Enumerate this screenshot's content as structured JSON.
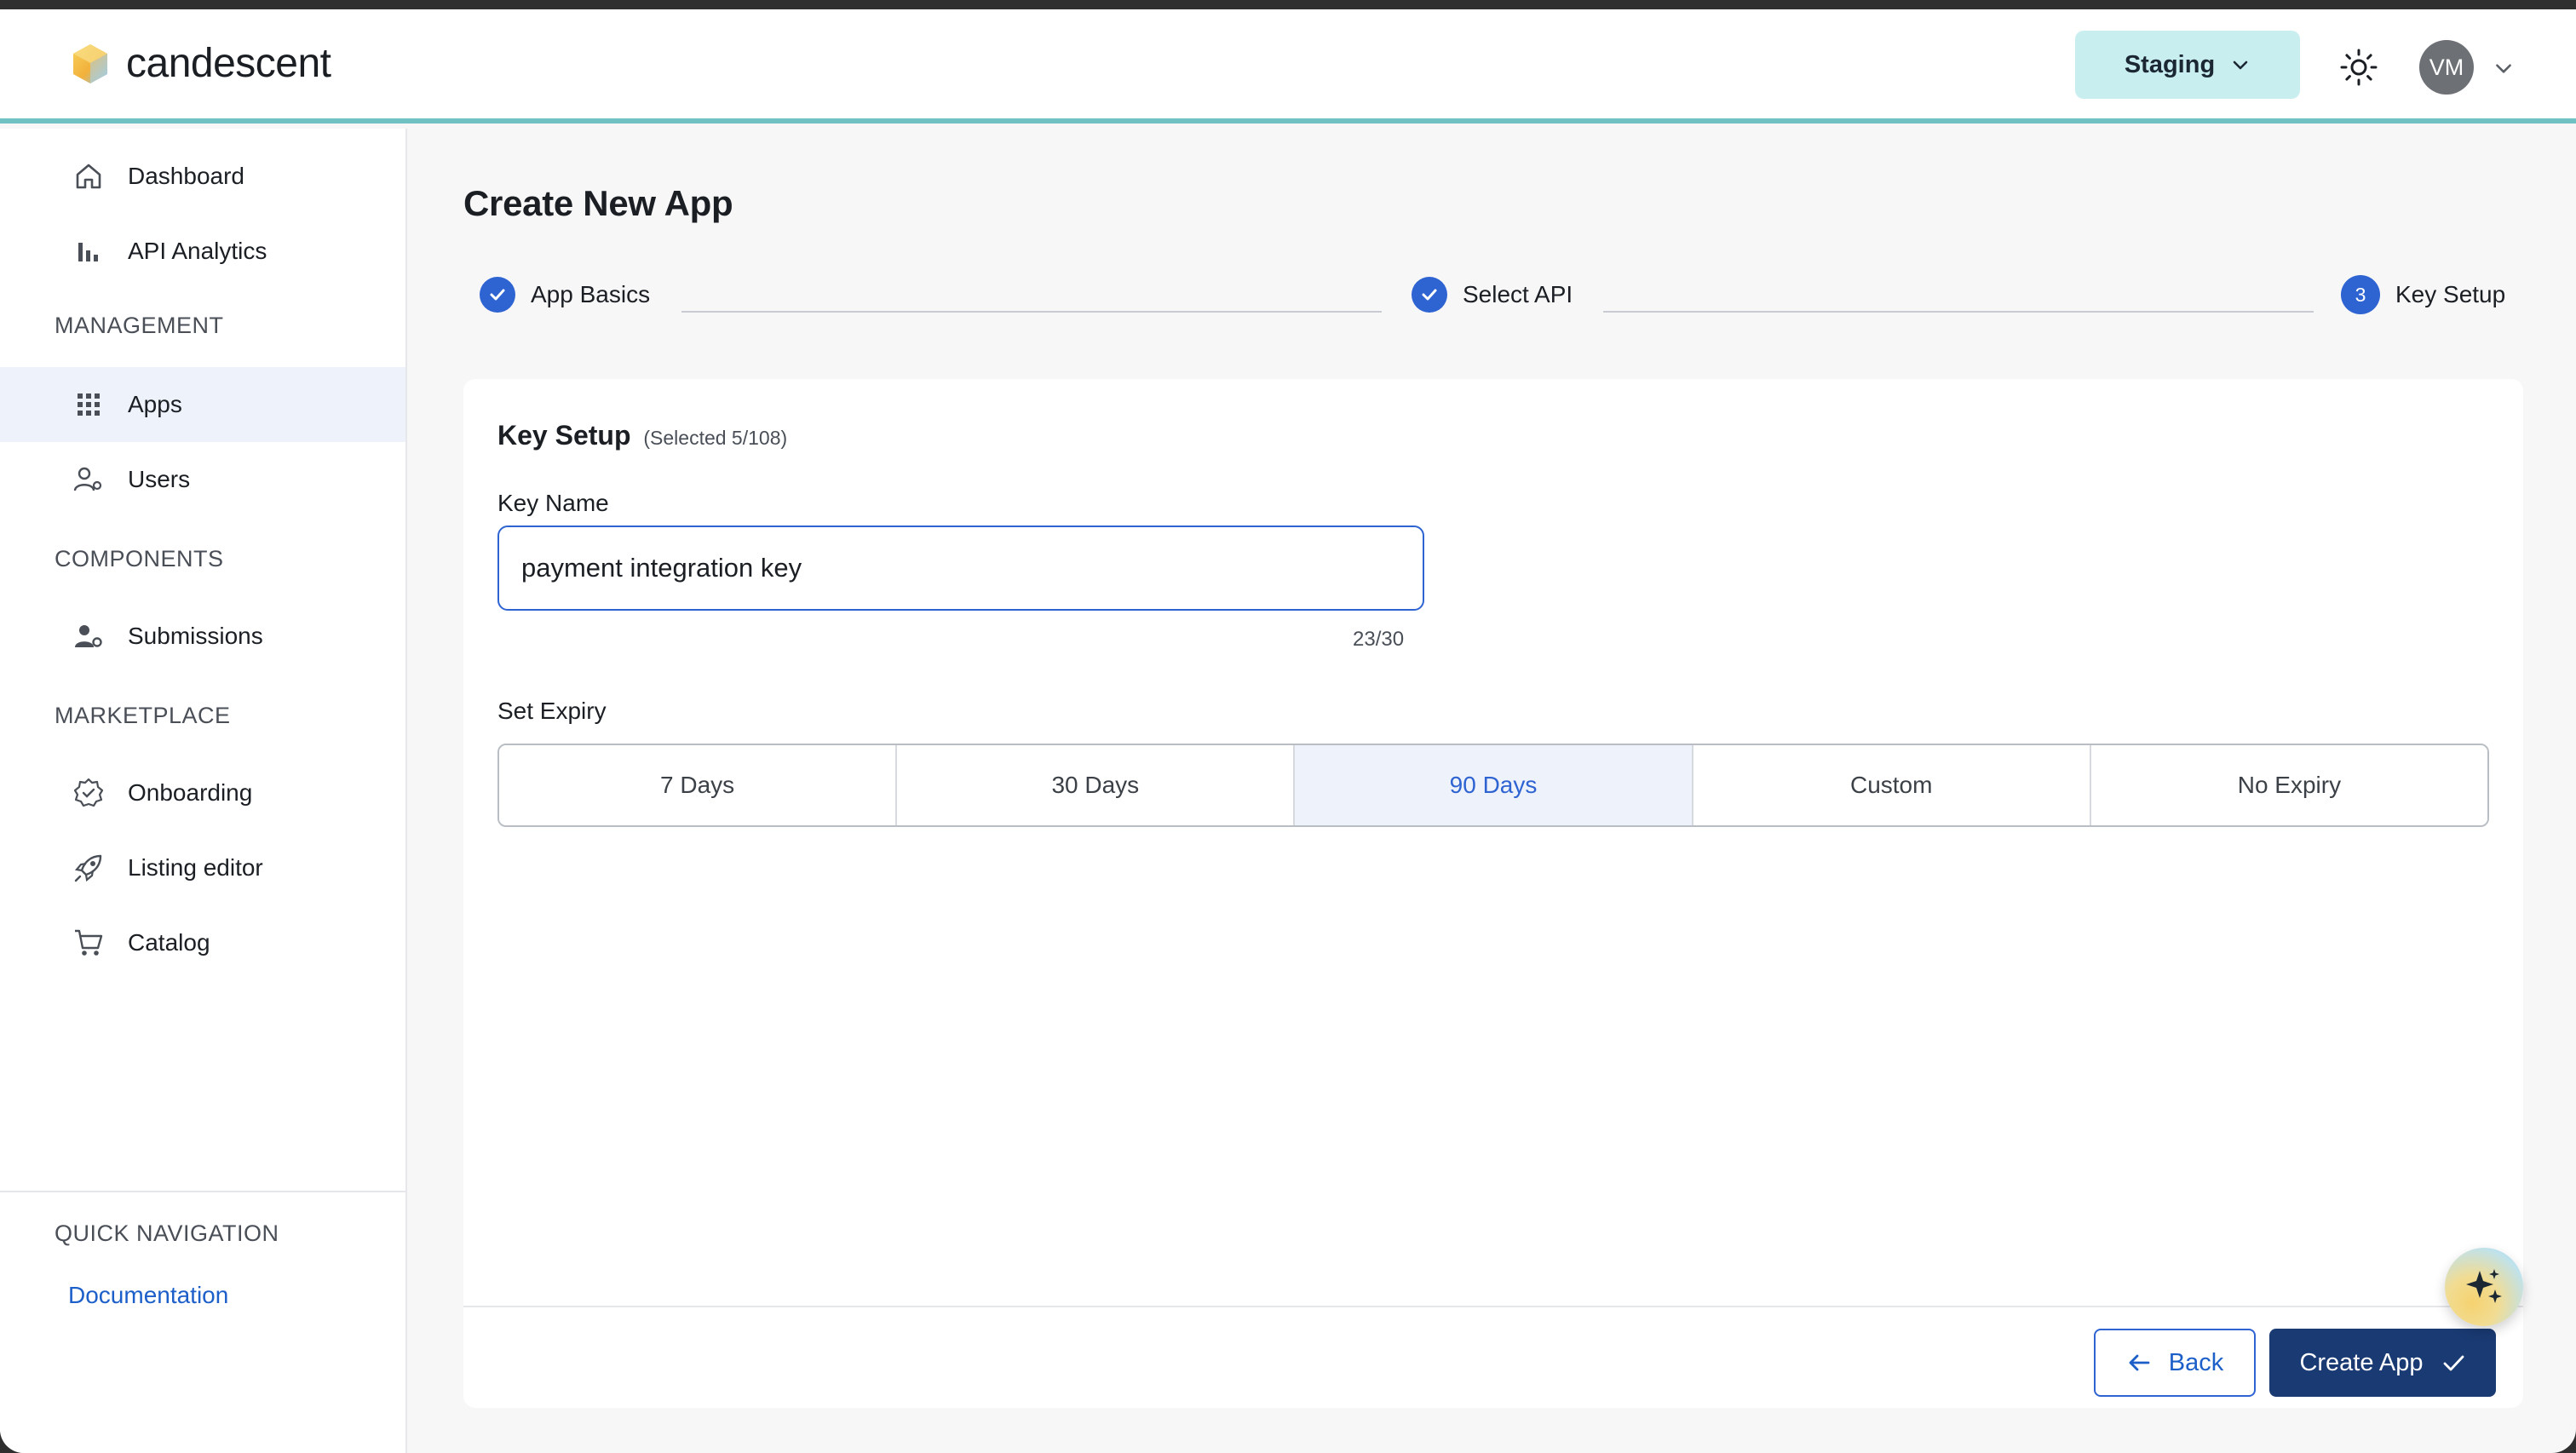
{
  "brand": {
    "name": "candescent"
  },
  "header": {
    "environment_label": "Staging",
    "avatar_initials": "VM"
  },
  "sidebar": {
    "items_top": [
      {
        "label": "Dashboard",
        "icon": "home-icon"
      },
      {
        "label": "API Analytics",
        "icon": "bar-chart-icon"
      }
    ],
    "sections": [
      {
        "title": "MANAGEMENT",
        "items": [
          {
            "label": "Apps",
            "icon": "grid-icon",
            "active": true
          },
          {
            "label": "Users",
            "icon": "user-gear-icon"
          }
        ]
      },
      {
        "title": "COMPONENTS",
        "items": [
          {
            "label": "Submissions",
            "icon": "user-settings-icon"
          }
        ]
      },
      {
        "title": "MARKETPLACE",
        "items": [
          {
            "label": "Onboarding",
            "icon": "badge-check-icon"
          },
          {
            "label": "Listing editor",
            "icon": "rocket-icon"
          },
          {
            "label": "Catalog",
            "icon": "cart-icon"
          }
        ]
      }
    ],
    "quick_nav": {
      "title": "QUICK NAVIGATION",
      "link": "Documentation"
    }
  },
  "main": {
    "title": "Create New App",
    "steps": [
      {
        "label": "App Basics",
        "state": "done"
      },
      {
        "label": "Select API",
        "state": "done"
      },
      {
        "label": "Key Setup",
        "state": "current",
        "number": "3"
      }
    ],
    "card": {
      "title": "Key Setup",
      "subtitle": "(Selected 5/108)",
      "key_name_label": "Key Name",
      "key_name_value": "payment integration key",
      "char_count": "23/30",
      "expiry_label": "Set Expiry",
      "expiry_options": [
        "7 Days",
        "30 Days",
        "90 Days",
        "Custom",
        "No Expiry"
      ],
      "expiry_selected": "90 Days",
      "back_label": "Back",
      "create_label": "Create App"
    }
  },
  "colors": {
    "accent": "#2e63d2",
    "primary_button": "#1a3a73",
    "header_rule": "#6fc2c1",
    "env_button": "#c9eef0"
  }
}
